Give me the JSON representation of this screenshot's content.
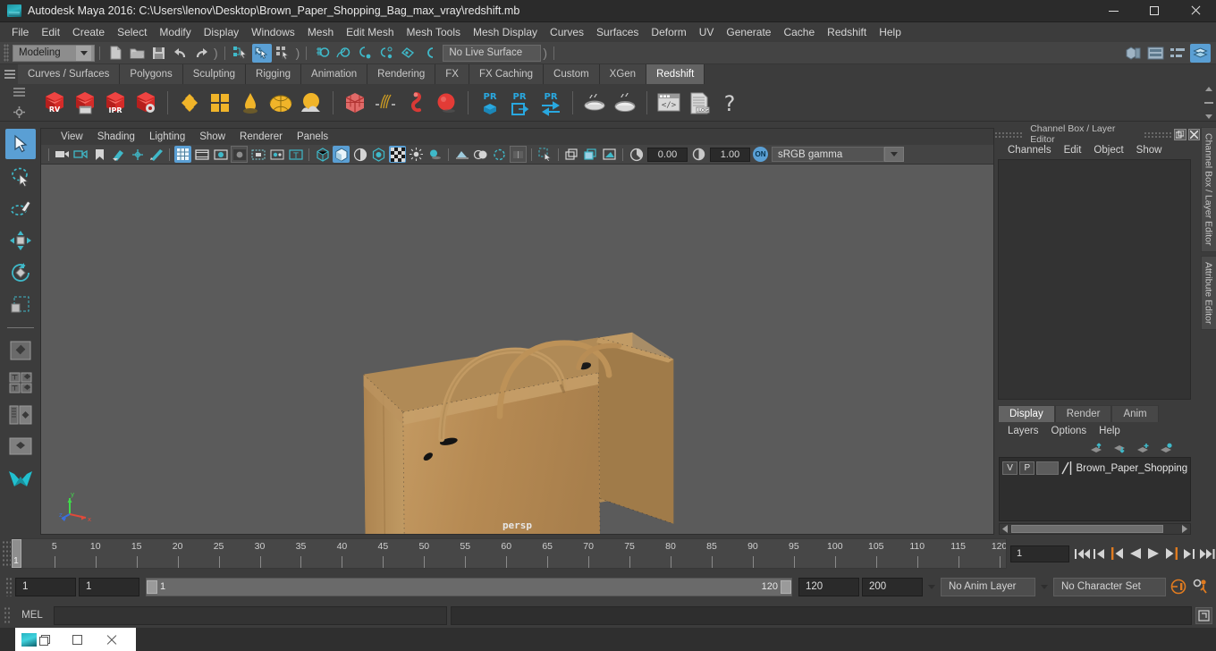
{
  "titlebar": {
    "title": "Autodesk Maya 2016: C:\\Users\\lenov\\Desktop\\Brown_Paper_Shopping_Bag_max_vray\\redshift.mb",
    "app_icon": "maya-icon",
    "minimize": "minimize-icon",
    "maximize": "maximize-icon",
    "close": "close-icon"
  },
  "menubar": {
    "items": [
      {
        "label": "File"
      },
      {
        "label": "Edit"
      },
      {
        "label": "Create"
      },
      {
        "label": "Select"
      },
      {
        "label": "Modify"
      },
      {
        "label": "Display"
      },
      {
        "label": "Windows"
      },
      {
        "label": "Mesh"
      },
      {
        "label": "Edit Mesh"
      },
      {
        "label": "Mesh Tools"
      },
      {
        "label": "Mesh Display"
      },
      {
        "label": "Curves"
      },
      {
        "label": "Surfaces"
      },
      {
        "label": "Deform"
      },
      {
        "label": "UV"
      },
      {
        "label": "Generate"
      },
      {
        "label": "Cache"
      },
      {
        "label": "Redshift"
      },
      {
        "label": "Help"
      }
    ]
  },
  "statusbar": {
    "menu_set": "Modeling",
    "live_surface": "No Live Surface",
    "icons": [
      "new-scene-icon",
      "open-scene-icon",
      "save-scene-icon",
      "undo-icon",
      "redo-icon",
      "select-hierarchy-icon",
      "select-object-icon",
      "select-component-icon",
      "snap-grid-icon",
      "snap-curve-icon",
      "snap-point-icon",
      "snap-projected-icon",
      "snap-view-plane-icon",
      "make-live-icon"
    ],
    "right_icons": [
      "show-hide-modeling-toolkit-icon",
      "attribute-editor-icon",
      "tool-settings-icon",
      "channel-box-layer-editor-icon"
    ]
  },
  "shelf": {
    "tabs": [
      {
        "label": "Curves / Surfaces",
        "active": false
      },
      {
        "label": "Polygons",
        "active": false
      },
      {
        "label": "Sculpting",
        "active": false
      },
      {
        "label": "Rigging",
        "active": false
      },
      {
        "label": "Animation",
        "active": false
      },
      {
        "label": "Rendering",
        "active": false
      },
      {
        "label": "FX",
        "active": false
      },
      {
        "label": "FX Caching",
        "active": false
      },
      {
        "label": "Custom",
        "active": false
      },
      {
        "label": "XGen",
        "active": false
      },
      {
        "label": "Redshift",
        "active": true
      }
    ],
    "icon_labels": [
      "RV",
      "IPR",
      "PR",
      "PR",
      "PR",
      ".LOG"
    ],
    "icons": [
      "redshift-render-view-icon",
      "redshift-render-sequence-icon",
      "redshift-ipr-icon",
      "redshift-render-settings-icon",
      "redshift-lights-icon",
      "redshift-area-light-icon",
      "redshift-ies-light-icon",
      "redshift-dome-light-icon",
      "redshift-physical-sun-icon",
      "redshift-proxy-icon",
      "redshift-hair-icon",
      "redshift-volume-icon",
      "redshift-sphere-icon",
      "redshift-pr-object-icon",
      "redshift-pr-export-icon",
      "redshift-pr-exchange-icon",
      "redshift-bake-icon",
      "redshift-bake-all-icon",
      "redshift-script-icon",
      "redshift-log-icon",
      "redshift-help-icon"
    ]
  },
  "toolbox": {
    "icons": [
      "select-tool-icon",
      "lasso-select-tool-icon",
      "paint-select-tool-icon",
      "move-tool-icon",
      "rotate-tool-icon",
      "scale-tool-icon",
      "single-perspective-layout-icon",
      "four-view-layout-icon",
      "outliner-persp-layout-icon",
      "persp-graph-layout-icon",
      "maya-logo-icon"
    ],
    "active": "select-tool-icon"
  },
  "viewport": {
    "menus": [
      {
        "label": "View"
      },
      {
        "label": "Shading"
      },
      {
        "label": "Lighting"
      },
      {
        "label": "Show"
      },
      {
        "label": "Renderer"
      },
      {
        "label": "Panels"
      }
    ],
    "exposure_value": "0.00",
    "gamma_value": "1.00",
    "color_mgmt_toggle": "ON",
    "color_profile": "sRGB gamma",
    "camera_label": "persp",
    "toolbar_icons": [
      "select-camera-icon",
      "camera-attributes-icon",
      "bookmark-icon",
      "image-plane-icon",
      "2d-pan-zoom-icon",
      "grease-pencil-icon",
      "grid-icon",
      "film-gate-icon",
      "resolution-gate-icon",
      "gate-mask-icon",
      "film-origin-icon",
      "safe-action-icon",
      "title-safe-icon",
      "wireframe-icon",
      "smooth-shade-icon",
      "shaded-wireframe-icon",
      "textured-icon",
      "use-default-lighting-icon",
      "use-all-lights-icon",
      "shadows-icon",
      "screen-space-ao-icon",
      "motion-blur-icon",
      "multisample-icon",
      "xray-icon",
      "xray-joints-icon",
      "isolate-select-icon",
      "display-layer-icon",
      "viewport-panel-icon",
      "grab-icon",
      "exposure-icon",
      "gamma-icon",
      "color-mgmt-icon"
    ]
  },
  "channel_box": {
    "panel_title": "Channel Box / Layer Editor",
    "menus": [
      {
        "label": "Channels"
      },
      {
        "label": "Edit"
      },
      {
        "label": "Object"
      },
      {
        "label": "Show"
      }
    ],
    "undock_icon": "undock-icon",
    "close_icon": "close-panel-icon",
    "side_tabs": [
      "Channel Box / Layer Editor",
      "Attribute Editor"
    ]
  },
  "layer_editor": {
    "tabs": [
      {
        "label": "Display",
        "active": true
      },
      {
        "label": "Render",
        "active": false
      },
      {
        "label": "Anim",
        "active": false
      }
    ],
    "menus": [
      {
        "label": "Layers"
      },
      {
        "label": "Options"
      },
      {
        "label": "Help"
      }
    ],
    "tool_icons": [
      "move-layer-up-icon",
      "move-layer-down-icon",
      "new-layer-icon",
      "new-layer-from-selection-icon"
    ],
    "layers": [
      {
        "visibility": "V",
        "playback": "P",
        "name": "Brown_Paper_Shopping_"
      }
    ],
    "scroll_left_icon": "scroll-left-icon",
    "scroll_right_icon": "scroll-right-icon"
  },
  "timeline": {
    "current_frame": "1",
    "frame_field": "1",
    "ticks": [
      5,
      10,
      15,
      20,
      25,
      30,
      35,
      40,
      45,
      50,
      55,
      60,
      65,
      70,
      75,
      80,
      85,
      90,
      95,
      100,
      105,
      110,
      115,
      120
    ],
    "playback_buttons": [
      "go-to-start-icon",
      "step-back-frame-icon",
      "step-back-key-icon",
      "play-backwards-icon",
      "play-forwards-icon",
      "step-forward-key-icon",
      "step-forward-frame-icon",
      "go-to-end-icon"
    ]
  },
  "range_slider": {
    "anim_start": "1",
    "playback_start": "1",
    "slider_start_label": "1",
    "slider_end_label": "120",
    "playback_end": "120",
    "anim_end": "200",
    "anim_layer": "No Anim Layer",
    "character_set": "No Character Set",
    "icons": [
      "auto-keyframe-icon",
      "animation-preferences-icon"
    ]
  },
  "command_line": {
    "language": "MEL",
    "input_value": "",
    "output_value": "",
    "script-editor-icon": "script-editor-icon"
  },
  "taskbar": {
    "window_icon": "maya-icon",
    "restore_icon": "restore-icon",
    "maximize_icon": "maximize-icon",
    "close_icon": "close-icon"
  },
  "colors": {
    "accent_blue": "#5a9fd4",
    "panel_bg": "#3c3c3c",
    "viewport_bg": "#5b5b5b",
    "bag_color": "#b08a56",
    "redshift_red": "#cc2222",
    "shelf_yellow": "#f0b429",
    "orange_marker": "#e07b20"
  }
}
